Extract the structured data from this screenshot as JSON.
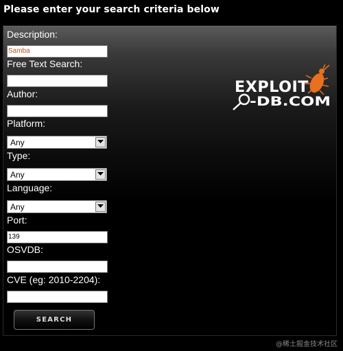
{
  "page": {
    "title": "Please enter your search criteria below"
  },
  "form": {
    "description": {
      "label": "Description:",
      "value": "Samba"
    },
    "free_text": {
      "label": "Free Text Search:",
      "value": ""
    },
    "author": {
      "label": "Author:",
      "value": ""
    },
    "platform": {
      "label": "Platform:",
      "value": "Any"
    },
    "type": {
      "label": "Type:",
      "value": "Any"
    },
    "language": {
      "label": "Language:",
      "value": "Any"
    },
    "port": {
      "label": "Port:",
      "value": "139"
    },
    "osvdb": {
      "label": "OSVDB:",
      "value": ""
    },
    "cve": {
      "label": "CVE (eg: 2010-2204):",
      "value": ""
    },
    "search_button": "SEARCH"
  },
  "logo": {
    "line1": "EXPLOIT",
    "line2": "-DB.COM",
    "accent_color": "#e8701e"
  },
  "watermark": "@稀土掘金技术社区"
}
